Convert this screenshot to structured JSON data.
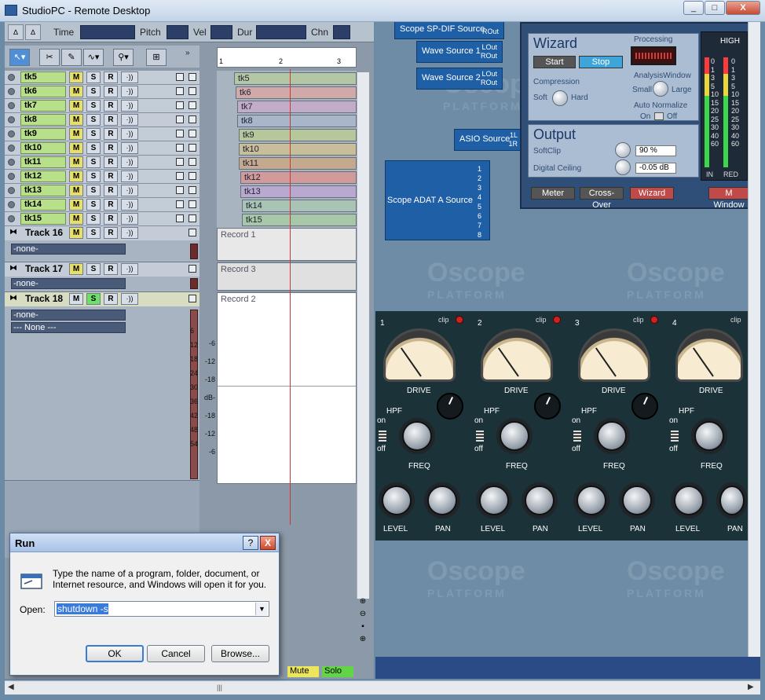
{
  "window": {
    "title": "StudioPC - Remote Desktop",
    "minimize": "_",
    "maximize": "□",
    "close": "X"
  },
  "transport": {
    "time_label": "Time",
    "pitch_label": "Pitch",
    "vel_label": "Vel",
    "dur_label": "Dur",
    "chn_label": "Chn"
  },
  "ruler": {
    "ticks": [
      "1",
      "2",
      "3"
    ]
  },
  "tracks": [
    {
      "name": "tk5",
      "mute": "M",
      "solo": "S",
      "rec": "R",
      "fx": "·))"
    },
    {
      "name": "tk6",
      "mute": "M",
      "solo": "S",
      "rec": "R",
      "fx": "·))"
    },
    {
      "name": "tk7",
      "mute": "M",
      "solo": "S",
      "rec": "R",
      "fx": "·))"
    },
    {
      "name": "tk8",
      "mute": "M",
      "solo": "S",
      "rec": "R",
      "fx": "·))"
    },
    {
      "name": "tk9",
      "mute": "M",
      "solo": "S",
      "rec": "R",
      "fx": "·))"
    },
    {
      "name": "tk10",
      "mute": "M",
      "solo": "S",
      "rec": "R",
      "fx": "·))"
    },
    {
      "name": "tk11",
      "mute": "M",
      "solo": "S",
      "rec": "R",
      "fx": "·))"
    },
    {
      "name": "tk12",
      "mute": "M",
      "solo": "S",
      "rec": "R",
      "fx": "·))"
    },
    {
      "name": "tk13",
      "mute": "M",
      "solo": "S",
      "rec": "R",
      "fx": "·))"
    },
    {
      "name": "tk14",
      "mute": "M",
      "solo": "S",
      "rec": "R",
      "fx": "·))"
    },
    {
      "name": "tk15",
      "mute": "M",
      "solo": "S",
      "rec": "R",
      "fx": "·))"
    }
  ],
  "big_tracks": [
    {
      "name": "Track 16",
      "input": "-none-",
      "clip": "Record 1"
    },
    {
      "name": "Track 17",
      "input": "-none-",
      "clip": "Record 3"
    },
    {
      "name": "Track 18",
      "input": "-none-",
      "output": "--- None ---",
      "clip": "Record 2"
    }
  ],
  "meter_scale": [
    "6",
    "12",
    "18",
    "24",
    "30",
    "36",
    "42",
    "48",
    "54"
  ],
  "db_scale": [
    "-6",
    "-12",
    "-18",
    "dB-",
    "-18",
    "-12",
    "-6"
  ],
  "bottom": {
    "mute": "Mute",
    "solo": "Solo"
  },
  "scope": {
    "watermark": "Oscope",
    "watermark_sub": "PLATFORM",
    "sources": {
      "spdif": "Scope SP-DIF Source",
      "wave1": "Wave Source 1",
      "wave2": "Wave Source 2",
      "asio": "ASIO Source",
      "adat": "Scope ADAT A Source",
      "lout": "LOut",
      "rout": "ROut",
      "asio_ports": [
        "1L",
        "1R"
      ],
      "adat_ports": [
        "1",
        "2",
        "3",
        "4",
        "5",
        "6",
        "7",
        "8"
      ]
    },
    "wizard": {
      "title": "Wizard",
      "processing": "Processing",
      "start": "Start",
      "stop": "Stop",
      "compression": "Compression",
      "soft": "Soft",
      "hard": "Hard",
      "analysis_window": "AnalysisWindow",
      "small": "Small",
      "large": "Large",
      "auto_normalize": "Auto Normalize",
      "on": "On",
      "off": "Off",
      "output_title": "Output",
      "softclip": "SoftClip",
      "softclip_value": "90 %",
      "digital_ceiling": "Digital Ceiling",
      "digital_ceiling_value": "-0.05 dB",
      "meter_btn": "Meter",
      "crossover_btn": "Cross-Over",
      "wizard_btn": "Wizard",
      "mwindow_btn": "M Window"
    },
    "hi_meter": {
      "label": "HIGH",
      "scale": [
        "0",
        "1",
        "3",
        "5",
        "10",
        "15",
        "20",
        "25",
        "30",
        "40",
        "60"
      ],
      "in": "IN",
      "red": "RED"
    },
    "rack": {
      "channels": [
        "1",
        "2",
        "3",
        "4"
      ],
      "clip": "clip",
      "drive": "DRIVE",
      "hpf": "HPF",
      "on": "on",
      "off": "off",
      "freq": "FREQ",
      "level": "LEVEL",
      "pan": "PAN"
    }
  },
  "run_dialog": {
    "title": "Run",
    "help": "?",
    "close": "X",
    "description": "Type the name of a program, folder, document, or Internet resource, and Windows will open it for you.",
    "open_label": "Open:",
    "open_value": "shutdown -s",
    "ok": "OK",
    "cancel": "Cancel",
    "browse": "Browse..."
  }
}
